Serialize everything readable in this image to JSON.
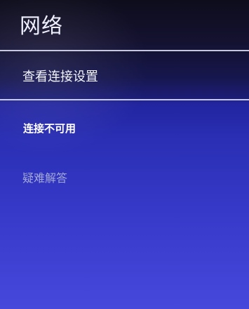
{
  "header": {
    "title": "网络"
  },
  "menu": {
    "connection_settings_label": "查看连接设置"
  },
  "status": {
    "message": "连接不可用"
  },
  "links": {
    "troubleshoot_label": "疑难解答"
  },
  "colors": {
    "background_top": "#0e0d1c",
    "background_bottom": "#4648dc",
    "divider": "#ebeeff",
    "text_primary": "#ffffff",
    "text_secondary": "#a3a8d8"
  }
}
